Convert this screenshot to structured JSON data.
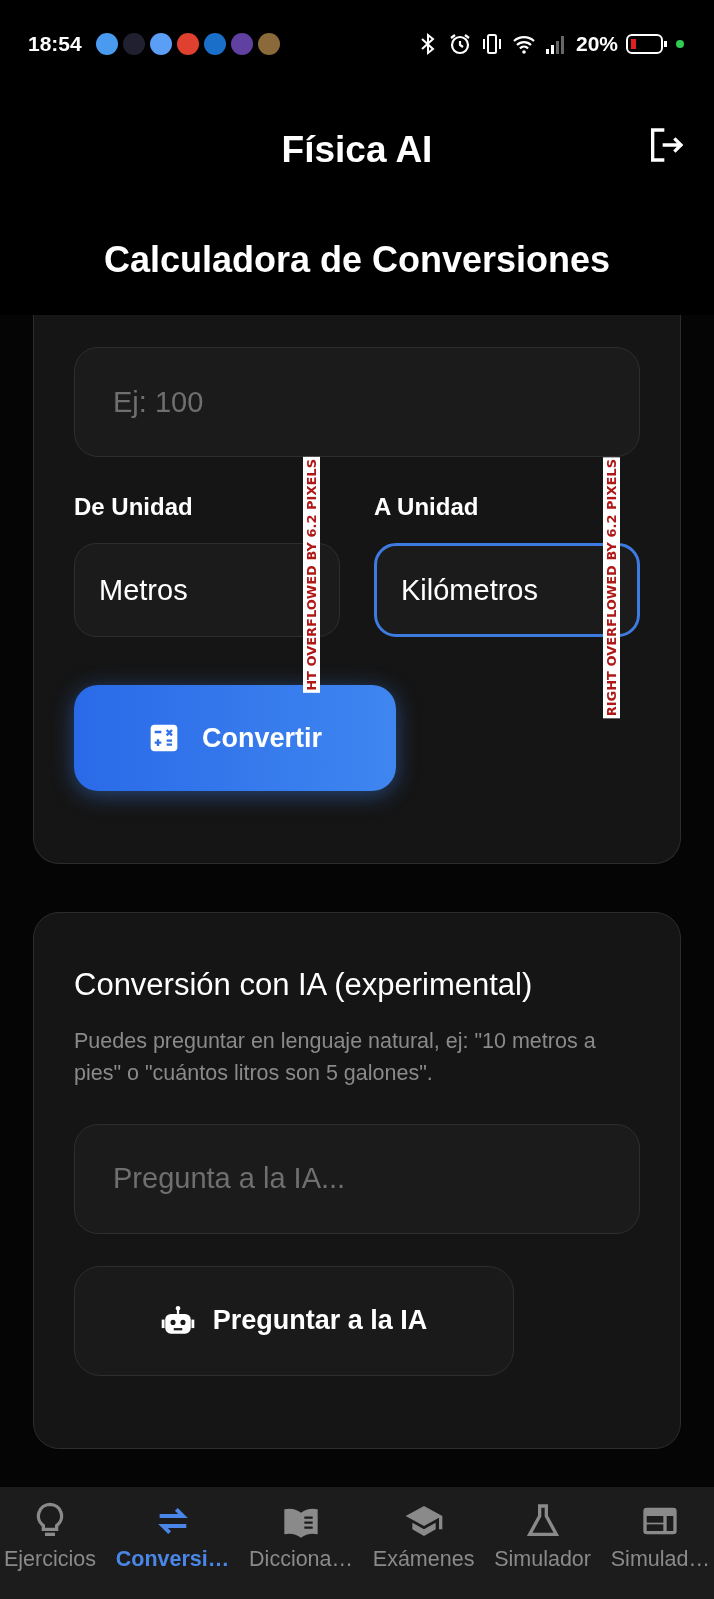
{
  "status_bar": {
    "time": "18:54",
    "battery_text": "20%"
  },
  "app_bar": {
    "title": "Física AI"
  },
  "page_title": "Calculadora de Conversiones",
  "converter": {
    "value_field": {
      "placeholder": "Ej: 100"
    },
    "from": {
      "label": "De Unidad",
      "value": "Metros",
      "focused": false,
      "overflow_warning": "HT OVERFLOWED BY 6.2 PIXELS"
    },
    "to": {
      "label": "A Unidad",
      "value": "Kilómetros",
      "focused": true,
      "overflow_warning": "RIGHT OVERFLOWED BY 6.2 PIXELS"
    },
    "button": "Convertir"
  },
  "ai": {
    "title": "Conversión con IA (experimental)",
    "description": "Puedes preguntar en lenguaje natural, ej: \"10 metros a pies\" o \"cuántos litros son 5 galones\".",
    "field": {
      "placeholder": "Pregunta a la IA..."
    },
    "button": "Preguntar a la IA"
  },
  "bottom_nav": [
    {
      "label": "Ejercicios",
      "kind": "bulb",
      "selected": false
    },
    {
      "label": "Conversi…",
      "kind": "swap",
      "selected": true
    },
    {
      "label": "Dicciona…",
      "kind": "book",
      "selected": false
    },
    {
      "label": "Exámenes",
      "kind": "cap",
      "selected": false
    },
    {
      "label": "Simulador",
      "kind": "flask",
      "selected": false
    },
    {
      "label": "Simulad…",
      "kind": "panel",
      "selected": false
    }
  ]
}
